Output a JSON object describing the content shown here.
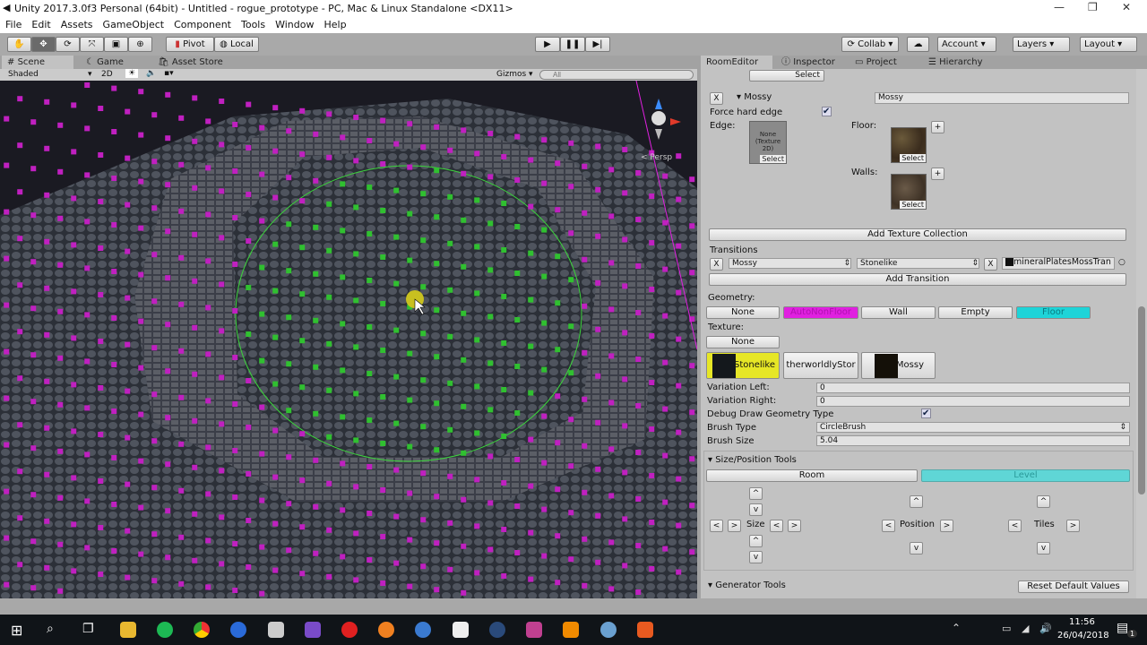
{
  "window": {
    "title": "Unity 2017.3.0f3 Personal (64bit) - Untitled - rogue_prototype - PC, Mac & Linux Standalone <DX11>"
  },
  "menu": [
    "File",
    "Edit",
    "Assets",
    "GameObject",
    "Component",
    "Tools",
    "Window",
    "Help"
  ],
  "toolbar": {
    "pivot": "Pivot",
    "local": "Local",
    "collab": "Collab",
    "account": "Account",
    "layers": "Layers",
    "layout": "Layout"
  },
  "scene_tabs": [
    "Scene",
    "Game",
    "Asset Store"
  ],
  "scene_bar": {
    "shading": "Shaded",
    "mode_2d": "2D",
    "gizmos": "Gizmos",
    "search_placeholder": "All"
  },
  "scene": {
    "persp": "< Persp"
  },
  "panel_tabs": [
    "RoomEditor",
    "Inspector",
    "Project",
    "Hierarchy"
  ],
  "room_editor": {
    "top_select": "Select",
    "collection": {
      "x": "X",
      "name": "Mossy",
      "name_value": "Mossy",
      "force_hard_edge_label": "Force hard edge",
      "force_hard_edge": true,
      "edge_label": "Edge:",
      "edge_value": "None (Texture 2D)",
      "floor_label": "Floor:",
      "walls_label": "Walls:",
      "select": "Select",
      "x_small": "x",
      "plus": "+"
    },
    "add_texture_collection": "Add Texture Collection",
    "transitions_label": "Transitions",
    "transition": {
      "from": "Mossy",
      "to": "Stonelike",
      "texture": "mineralPlatesMossTran"
    },
    "add_transition": "Add Transition",
    "geometry_label": "Geometry:",
    "geometry": [
      {
        "label": "None",
        "color": ""
      },
      {
        "label": "AutoNonFloor",
        "color": "#e020e0"
      },
      {
        "label": "Wall",
        "color": ""
      },
      {
        "label": "Empty",
        "color": ""
      },
      {
        "label": "Floor",
        "color": "#1ed4d8"
      }
    ],
    "texture_label": "Texture:",
    "texture_none": "None",
    "textures": [
      {
        "label": "Stonelike",
        "selected": true,
        "color": "#e6e626"
      },
      {
        "label": "therworldlyStor",
        "selected": false
      },
      {
        "label": "Mossy",
        "selected": false
      }
    ],
    "variation_left_label": "Variation Left:",
    "variation_left": "0",
    "variation_right_label": "Variation Right:",
    "variation_right": "0",
    "debug_draw_label": "Debug Draw Geometry Type",
    "debug_draw": true,
    "brush_type_label": "Brush Type",
    "brush_type": "CircleBrush",
    "brush_size_label": "Brush Size",
    "brush_size": "5.04",
    "size_position_tools": "Size/Position Tools",
    "room": "Room",
    "level": "Level",
    "size": "Size",
    "position": "Position",
    "tiles": "Tiles",
    "up": "^",
    "down": "v",
    "left": "<",
    "right": ">",
    "generator_tools": "Generator Tools",
    "reset_defaults": "Reset Default Values"
  },
  "taskbar": {
    "time": "11:56",
    "date": "26/04/2018",
    "notifications": "1"
  }
}
